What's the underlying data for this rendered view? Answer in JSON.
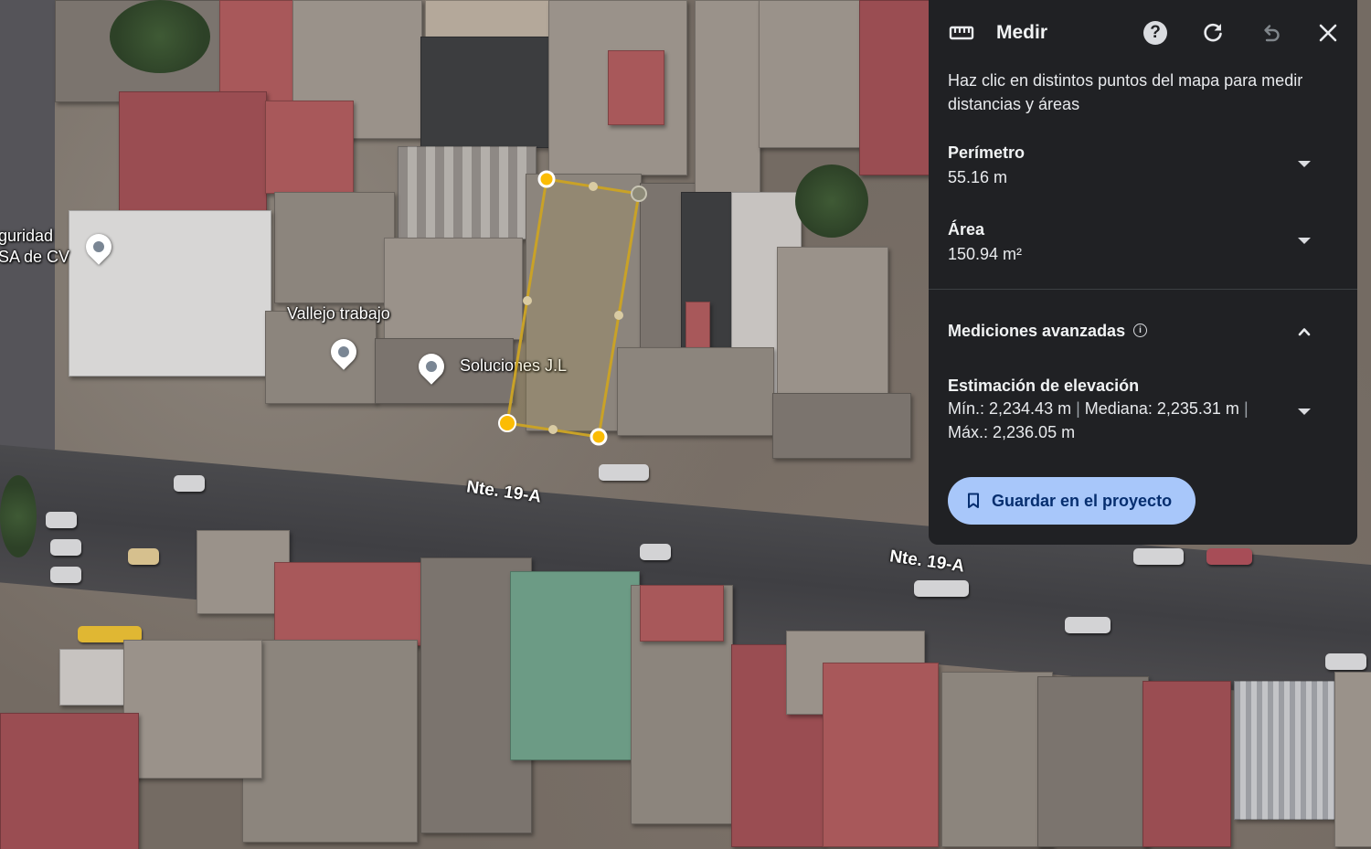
{
  "map": {
    "pois": [
      {
        "label": "guridad",
        "label2": "SA de CV"
      },
      {
        "label": "Vallejo trabajo"
      },
      {
        "label": "Soluciones J.L"
      }
    ],
    "streets": [
      "Nte. 19-A",
      "Nte. 19-A"
    ],
    "measure_line_color": "#c9a227",
    "measure_point_color": "#fbbc04"
  },
  "panel": {
    "title": "Medir",
    "icons": [
      "ruler-icon",
      "help-icon",
      "refresh-icon",
      "undo-icon",
      "close-icon"
    ],
    "instructions": "Haz clic en distintos puntos del mapa para medir distancias y áreas",
    "perimeter": {
      "label": "Perímetro",
      "value": "55.16 m"
    },
    "area": {
      "label": "Área",
      "value": "150.94 m²"
    },
    "advanced": {
      "title": "Mediciones avanzadas"
    },
    "elevation": {
      "label": "Estimación de elevación",
      "min": "Mín.: 2,234.43 m",
      "median": "Mediana: 2,235.31 m",
      "max": "Máx.: 2,236.05 m",
      "separator": "|"
    },
    "save_button": "Guardar en el proyecto",
    "accent_color": "#a8c7fa",
    "background_color": "#202124"
  }
}
